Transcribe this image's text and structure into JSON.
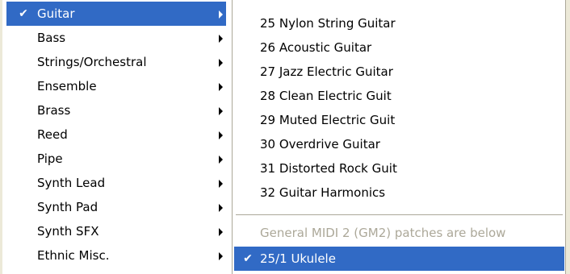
{
  "instruments_menu": {
    "items": [
      {
        "label": "Guitar",
        "checked": true
      },
      {
        "label": "Bass"
      },
      {
        "label": "Strings/Orchestral"
      },
      {
        "label": "Ensemble"
      },
      {
        "label": "Brass"
      },
      {
        "label": "Reed"
      },
      {
        "label": "Pipe"
      },
      {
        "label": "Synth Lead"
      },
      {
        "label": "Synth Pad"
      },
      {
        "label": "Synth SFX"
      },
      {
        "label": "Ethnic Misc."
      }
    ],
    "check_glyph": "✔"
  },
  "guitar_submenu": {
    "items": [
      {
        "label": "25 Nylon String Guitar"
      },
      {
        "label": "26 Acoustic Guitar"
      },
      {
        "label": "27 Jazz Electric Guitar"
      },
      {
        "label": "28 Clean Electric Guit"
      },
      {
        "label": "29 Muted Electric Guit"
      },
      {
        "label": "30 Overdrive Guitar"
      },
      {
        "label": "31 Distorted Rock Guit"
      },
      {
        "label": "32 Guitar Harmonics"
      }
    ],
    "gm2_header": "General MIDI 2 (GM2) patches are below",
    "gm2_items": [
      {
        "label": "25/1 Ukulele",
        "checked": true
      }
    ]
  },
  "colors": {
    "highlight": "#316ac5",
    "disabled_text": "#aca899"
  }
}
